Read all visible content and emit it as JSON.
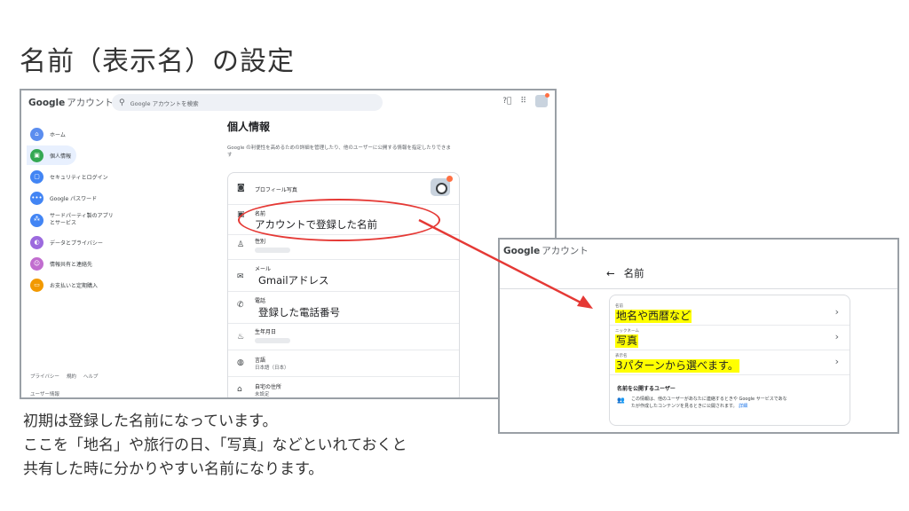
{
  "slide": {
    "title": "名前（表示名）の設定",
    "caption_lines": [
      "初期は登録した名前になっています。",
      "ここを「地名」や旅行の日、「写真」などといれておくと",
      "共有した時に分かりやすい名前になります。"
    ]
  },
  "left": {
    "brand": "Google",
    "brand_sub": "アカウント",
    "search_placeholder": "Google アカウントを検索",
    "nav": [
      {
        "label": "ホーム",
        "icon": "home-icon",
        "color": "#5b8def"
      },
      {
        "label": "個人情報",
        "icon": "id-card-icon",
        "color": "#34a853"
      },
      {
        "label": "セキュリティとログイン",
        "icon": "lock-icon",
        "color": "#4285f4"
      },
      {
        "label": "Google パスワード",
        "icon": "password-icon",
        "color": "#4285f4"
      },
      {
        "label": "サードパーティ製のアプリ",
        "label2": "とサービス",
        "icon": "apps-icon",
        "color": "#4285f4"
      },
      {
        "label": "データとプライバシー",
        "icon": "toggle-icon",
        "color": "#9c6ade"
      },
      {
        "label": "情報共有と連絡先",
        "icon": "people-icon",
        "color": "#c16dcf"
      },
      {
        "label": "お支払いと定期購入",
        "icon": "card-icon",
        "color": "#f29900"
      }
    ],
    "footer_links": [
      "プライバシー",
      "規約",
      "ヘルプ"
    ],
    "footer2": "ユーザー情報",
    "main_title": "個人情報",
    "main_desc": "Google の利便性を高めるための詳細を管理したり、他のユーザーに公開する情報を指定したりできます",
    "rows": {
      "photo": "プロフィール写真",
      "name_label": "名前",
      "name_overlay": "アカウントで登録した名前",
      "gender": "性別",
      "email_label": "メール",
      "email_overlay": "Gmailアドレス",
      "phone_label": "電話",
      "phone_overlay": "登録した電話番号",
      "birthday": "生年月日",
      "language_label": "言語",
      "language_value": "日本語（日本）",
      "address_label": "自宅の住所",
      "address_value": "未設定"
    }
  },
  "right": {
    "brand": "Google",
    "brand_sub": "アカウント",
    "header": "名前",
    "rows": [
      {
        "small": "名前",
        "highlight": "地名や西暦など"
      },
      {
        "small": "ニックネーム",
        "highlight": "写真"
      },
      {
        "small": "表示名",
        "highlight": "3パターンから選べます。"
      }
    ],
    "section_title": "名前を公開するユーザー",
    "info_text": "この情報は、他のユーザーがあなたに連絡するときや Google サービスであなたが作成したコンテンツを見るときに公開されます。",
    "info_link": "詳細"
  },
  "colors": {
    "annotation_red": "#e53935",
    "highlight_yellow": "#ffff00"
  }
}
